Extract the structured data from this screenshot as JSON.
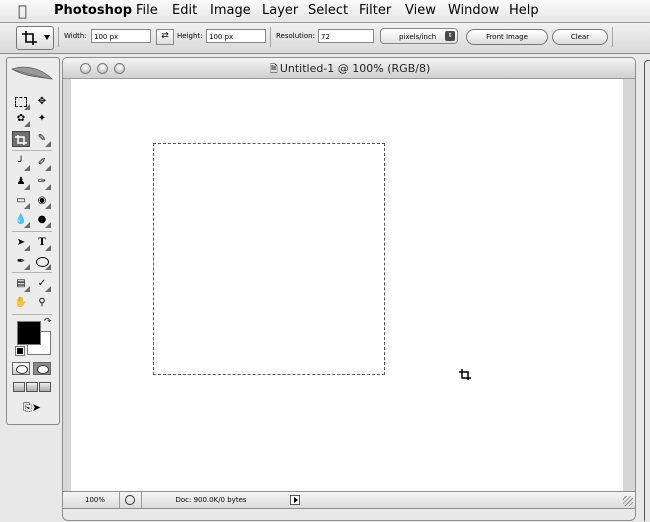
{
  "menubar": {
    "app_name": "Photoshop",
    "items": [
      "File",
      "Edit",
      "Image",
      "Layer",
      "Select",
      "Filter",
      "View",
      "Window",
      "Help"
    ]
  },
  "options_bar": {
    "width_label": "Width:",
    "width_value": "100 px",
    "height_label": "Height:",
    "height_value": "100 px",
    "resolution_label": "Resolution:",
    "resolution_value": "72",
    "resolution_units": "pixels/inch",
    "front_image_label": "Front Image",
    "clear_label": "Clear"
  },
  "toolbox": {
    "selected_tool": "crop-tool",
    "foreground_color": "#000000",
    "background_color": "#ffffff"
  },
  "document": {
    "title": "Untitled-1 @ 100% (RGB/8)"
  },
  "statusbar": {
    "zoom": "100%",
    "doc_info": "Doc: 900.0K/0 bytes"
  },
  "colors": {
    "selected_tool_bg": "#6f6f6f",
    "canvas": "#ffffff"
  }
}
